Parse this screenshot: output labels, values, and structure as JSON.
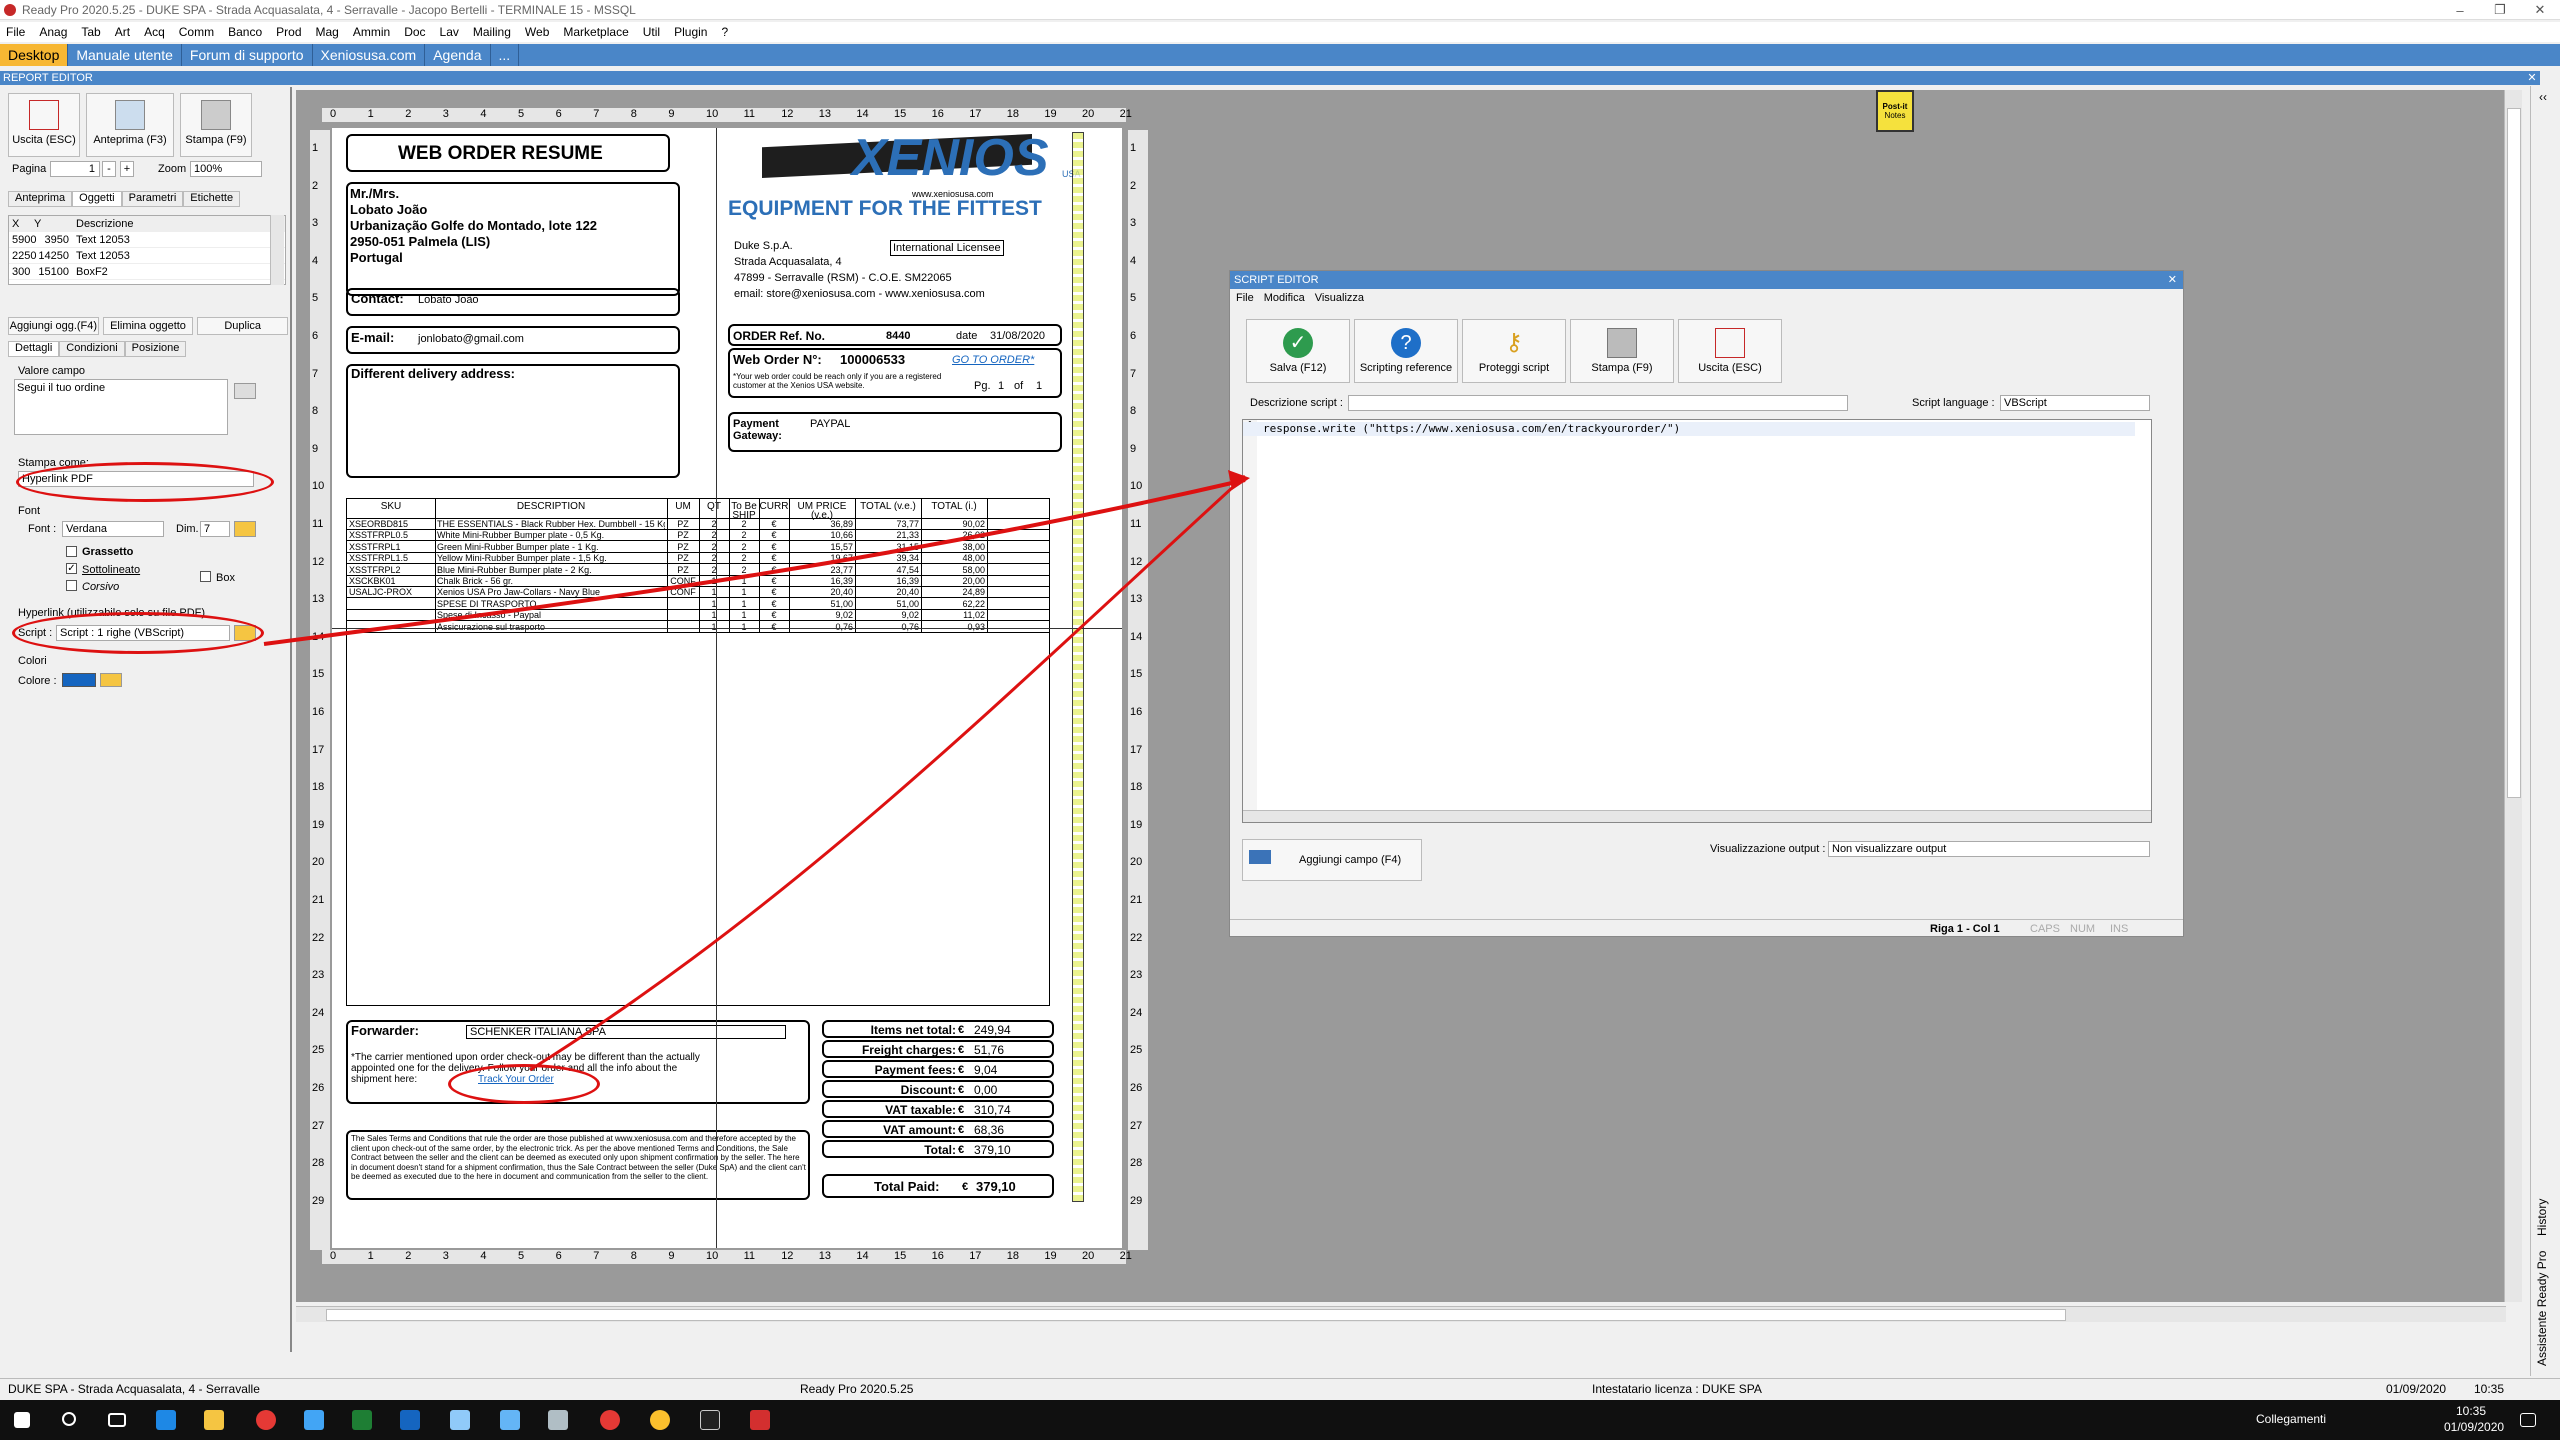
{
  "window": {
    "title": "Ready Pro 2020.5.25 - DUKE SPA - Strada Acquasalata, 4 - Serravalle - Jacopo Bertelli - TERMINALE 15 - MSSQL"
  },
  "menu": [
    "File",
    "Anag",
    "Tab",
    "Art",
    "Acq",
    "Comm",
    "Banco",
    "Prod",
    "Mag",
    "Ammin",
    "Doc",
    "Lav",
    "Mailing",
    "Web",
    "Marketplace",
    "Util",
    "Plugin",
    "?"
  ],
  "tabs": [
    "Desktop",
    "Manuale utente",
    "Forum di supporto",
    "Xeniosusa.com",
    "Agenda",
    "..."
  ],
  "report_editor": {
    "title": "REPORT EDITOR",
    "buttons": [
      "Uscita (ESC)",
      "Anteprima (F3)",
      "Stampa (F9)"
    ],
    "pagina_label": "Pagina",
    "pagina_value": "1",
    "minus": "-",
    "plus": "+",
    "zoom_label": "Zoom",
    "zoom_value": "100%",
    "subtabs": [
      "Anteprima",
      "Oggetti",
      "Parametri",
      "Etichette"
    ],
    "grid_headers": [
      "X",
      "Y",
      "Descrizione"
    ],
    "grid_rows": [
      [
        "5900",
        "3950",
        "Text 12053"
      ],
      [
        "2250",
        "14250",
        "Text 12053"
      ],
      [
        "300",
        "15100",
        "BoxF2"
      ]
    ],
    "obj_buttons": [
      "Aggiungi ogg.(F4)",
      "Elimina oggetto",
      "Duplica"
    ],
    "prop_tabs": [
      "Dettagli",
      "Condizioni",
      "Posizione"
    ],
    "valore_campo_label": "Valore campo",
    "valore_campo_value": "Segui il tuo ordine",
    "stampa_label": "Stampa come:",
    "stampa_value": "Hyperlink PDF",
    "font_group": "Font",
    "font_label": "Font :",
    "font_value": "Verdana",
    "dim_label": "Dim.",
    "dim_value": "7",
    "grassetto": "Grassetto",
    "sottolineato": "Sottolineato",
    "corsivo": "Corsivo",
    "box": "Box",
    "hyperlink_group": "Hyperlink (utilizzabile solo su file PDF)",
    "script_label": "Script :",
    "script_value": "Script : 1 righe (VBScript)",
    "colore_group": "Colori",
    "colore_label": "Colore :",
    "colore_value": "#1565c0"
  },
  "rulers": {
    "h": [
      "0",
      "1",
      "2",
      "3",
      "4",
      "5",
      "6",
      "7",
      "8",
      "9",
      "10",
      "11",
      "12",
      "13",
      "14",
      "15",
      "16",
      "17",
      "18",
      "19",
      "20",
      "21"
    ],
    "v": [
      "1",
      "2",
      "3",
      "4",
      "5",
      "6",
      "7",
      "8",
      "9",
      "10",
      "11",
      "12",
      "13",
      "14",
      "15",
      "16",
      "17",
      "18",
      "19",
      "20",
      "21",
      "22",
      "23",
      "24",
      "25",
      "26",
      "27",
      "28",
      "29"
    ]
  },
  "doc": {
    "title": "WEB ORDER RESUME",
    "logo": "XENIOS",
    "logo_usa": "USA",
    "logo_url": "www.xeniosusa.com",
    "tagline": "EQUIPMENT FOR THE FITTEST",
    "customer": [
      "Mr./Mrs.",
      "Lobato João",
      "Urbanização Golfe do Montado, lote 122",
      "2950-051 Palmela (LIS)",
      "Portugal"
    ],
    "contact_label": "Contact:",
    "contact_value": "Lobato João",
    "email_label": "E-mail:",
    "email_value": "jonlobato@gmail.com",
    "delivery_label": "Different delivery address:",
    "seller": [
      "Duke S.p.A.",
      "Strada Acquasalata, 4",
      "47899 - Serravalle (RSM) - C.O.E. SM22065",
      "email: store@xeniosusa.com - www.xeniosusa.com"
    ],
    "intl": "International Licensee",
    "order_ref_label": "ORDER Ref. No.",
    "order_ref_value": "8440",
    "date_label": "date",
    "date_value": "31/08/2020",
    "web_order_label": "Web Order N°:",
    "web_order_value": "100006533",
    "goto": "GO TO ORDER*",
    "web_note": "*Your web order could be reach only if you are a registered customer at the Xenios USA website.",
    "pg_label": "Pg.",
    "pg_value": "1",
    "of_label": "of",
    "of_value": "1",
    "payment_label": "Payment Gateway:",
    "payment_value": "PAYPAL",
    "table_headers": [
      "SKU",
      "DESCRIPTION",
      "UM",
      "QT",
      "To Be SHIP",
      "CURR",
      "UM PRICE (v.e.)",
      "TOTAL (v.e.)",
      "TOTAL (i.)"
    ],
    "rows": [
      [
        "XSEORBD815",
        "THE ESSENTIALS - Black Rubber Hex. Dumbbell - 15 Kg.",
        "PZ",
        "2",
        "2",
        "€",
        "36,89",
        "73,77",
        "90,02"
      ],
      [
        "XSSTFRPL0.5",
        "White Mini-Rubber Bumper plate - 0,5 Kg.",
        "PZ",
        "2",
        "2",
        "€",
        "10,66",
        "21,33",
        "26,02"
      ],
      [
        "XSSTFRPL1",
        "Green Mini-Rubber Bumper plate - 1 Kg.",
        "PZ",
        "2",
        "2",
        "€",
        "15,57",
        "31,15",
        "38,00"
      ],
      [
        "XSSTFRPL1.5",
        "Yellow Mini-Rubber Bumper plate - 1,5 Kg.",
        "PZ",
        "2",
        "2",
        "€",
        "19,67",
        "39,34",
        "48,00"
      ],
      [
        "XSSTFRPL2",
        "Blue Mini-Rubber Bumper plate - 2 Kg.",
        "PZ",
        "2",
        "2",
        "€",
        "23,77",
        "47,54",
        "58,00"
      ],
      [
        "XSCKBK01",
        "Chalk Brick - 56 gr.",
        "CONF",
        "1",
        "1",
        "€",
        "16,39",
        "16,39",
        "20,00"
      ],
      [
        "USALJC-PROX",
        "Xenios USA Pro Jaw-Collars - Navy Blue",
        "CONF",
        "1",
        "1",
        "€",
        "20,40",
        "20,40",
        "24,89"
      ],
      [
        "",
        "SPESE DI TRASPORTO",
        "",
        "1",
        "1",
        "€",
        "51,00",
        "51,00",
        "62,22"
      ],
      [
        "",
        "Spese di Incasso - Paypal",
        "",
        "1",
        "1",
        "€",
        "9,02",
        "9,02",
        "11,02"
      ],
      [
        "",
        "Assicurazione sul trasporto",
        "",
        "1",
        "1",
        "€",
        "0,76",
        "0,76",
        "0,93"
      ]
    ],
    "forwarder_label": "Forwarder:",
    "forwarder_value": "SCHENKER ITALIANA SPA",
    "carrier_note": "*The carrier mentioned upon order check-out may be different than the actually appointed one for the delivery. Follow your order and all the info about the shipment here:",
    "track_link": "Track Your Order",
    "totals": [
      [
        "Items net total:",
        "249,94"
      ],
      [
        "Freight charges:",
        "51,76"
      ],
      [
        "Payment fees:",
        "9,04"
      ],
      [
        "Discount:",
        "0,00"
      ],
      [
        "VAT taxable:",
        "310,74"
      ],
      [
        "VAT amount:",
        "68,36"
      ],
      [
        "Total:",
        "379,10"
      ]
    ],
    "total_paid_label": "Total Paid:",
    "total_paid_value": "379,10",
    "currency": "€",
    "terms": "The Sales Terms and Conditions that rule the order are those published at www.xeniosusa.com and therefore accepted by the client upon check-out of the same order, by the electronic trick. As per the above mentioned Terms and Conditions, the Sale Contract between the seller and the client can be deemed as executed only upon shipment confirmation by the seller. The here in document doesn't stand for a shipment confirmation, thus the Sale Contract between the seller (Duke SpA) and the client can't be deemed as executed due to the here in document and communication from the seller to the client."
  },
  "postit": {
    "line1": "Post-it",
    "line2": "Notes"
  },
  "script_editor": {
    "title": "SCRIPT EDITOR",
    "menu": [
      "File",
      "Modifica",
      "Visualizza"
    ],
    "buttons": [
      "Salva (F12)",
      "Scripting reference",
      "Proteggi script",
      "Stampa (F9)",
      "Uscita (ESC)"
    ],
    "desc_label": "Descrizione script :",
    "lang_label": "Script language :",
    "lang_value": "VBScript",
    "line_no": "1",
    "code": "response.write (\"https://www.xeniosusa.com/en/trackyourorder/\")",
    "add_field": "Aggiungi campo (F4)",
    "output_label": "Visualizzazione output :",
    "output_value": "Non visualizzare output",
    "status": [
      "Riga 1 - Col 1",
      "CAPS",
      "NUM",
      "INS"
    ]
  },
  "side_panel": {
    "history": "History",
    "assistant": "Assistente Ready Pro"
  },
  "statusbar": {
    "left": "DUKE SPA - Strada Acquasalata, 4 - Serravalle",
    "mid": "Ready Pro 2020.5.25",
    "lic": "Intestatario licenza : DUKE SPA",
    "date": "01/09/2020",
    "time": "10:35"
  },
  "taskbar": {
    "collegamenti": "Collegamenti",
    "time": "10:35",
    "date": "01/09/2020"
  }
}
